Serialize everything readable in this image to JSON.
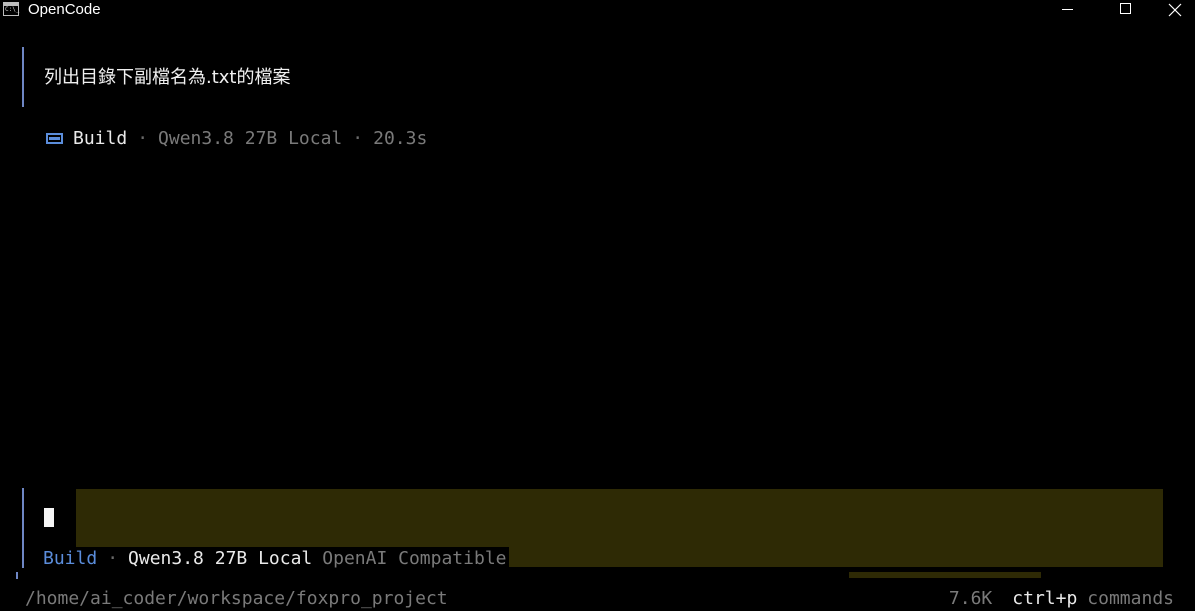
{
  "window": {
    "title": "OpenCode",
    "icon_glyph": "C:\\_",
    "icon": "terminal-icon"
  },
  "conversation": {
    "user_message": "列出目錄下副檔名為.txt的檔案",
    "meta": {
      "agent": "Build",
      "separator": "·",
      "model": "Qwen3.8 27B Local",
      "duration": "20.3s"
    }
  },
  "input": {
    "value": "",
    "status": {
      "agent": "Build",
      "separator": "·",
      "model": "Qwen3.8 27B Local",
      "provider": "OpenAI Compatible"
    }
  },
  "footer": {
    "path": "/home/ai_coder/workspace/foxpro_project",
    "tokens": "7.6K",
    "shortcut_key": "ctrl+p",
    "shortcut_label": "commands"
  },
  "colors": {
    "background": "#000000",
    "accent": "#5b8ddb",
    "input_background": "#2e2a05",
    "muted_text": "#7a7a7a"
  }
}
